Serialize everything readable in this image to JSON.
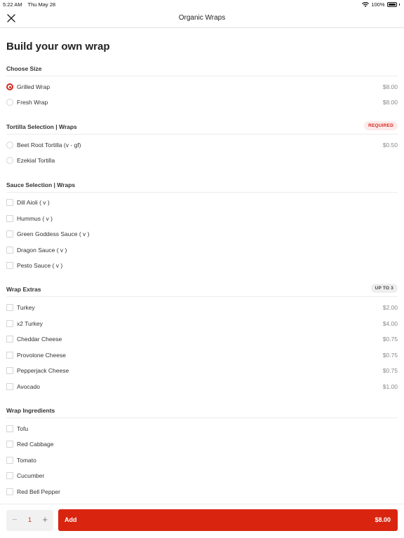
{
  "status_bar": {
    "time": "5:22 AM",
    "date": "Thu May 28",
    "battery": "100%"
  },
  "nav": {
    "title": "Organic Wraps",
    "close_icon": "close-icon"
  },
  "page_title": "Build your own wrap",
  "sections": {
    "size": {
      "title": "Choose Size",
      "options": [
        {
          "label": "Grilled Wrap",
          "price": "$8.00",
          "selected": true
        },
        {
          "label": "Fresh Wrap",
          "price": "$8.00",
          "selected": false
        }
      ]
    },
    "tortilla": {
      "title": "Tortilla Selection | Wraps",
      "badge": "REQUIRED",
      "options": [
        {
          "label": "Beet Root Tortilla (v - gf)",
          "price": "$0.50"
        },
        {
          "label": "Ezekial Tortilla",
          "price": ""
        }
      ]
    },
    "sauce": {
      "title": "Sauce Selection | Wraps",
      "options": [
        {
          "label": "Dill Aioli ( v )"
        },
        {
          "label": "Hummus ( v )"
        },
        {
          "label": "Green Goddess Sauce ( v )"
        },
        {
          "label": "Dragon Sauce ( v )"
        },
        {
          "label": "Pesto Sauce ( v )"
        }
      ]
    },
    "extras": {
      "title": "Wrap Extras",
      "badge": "UP TO 3",
      "options": [
        {
          "label": "Turkey",
          "price": "$2.00"
        },
        {
          "label": "x2 Turkey",
          "price": "$4.00"
        },
        {
          "label": "Cheddar Cheese",
          "price": "$0.75"
        },
        {
          "label": "Provolone Cheese",
          "price": "$0.75"
        },
        {
          "label": "Pepperjack Cheese",
          "price": "$0.75"
        },
        {
          "label": "Avocado",
          "price": "$1.00"
        }
      ]
    },
    "ingredients": {
      "title": "Wrap Ingredients",
      "options": [
        {
          "label": "Tofu"
        },
        {
          "label": "Red Cabbage"
        },
        {
          "label": "Tomato"
        },
        {
          "label": "Cucumber"
        },
        {
          "label": "Red Bell Pepper"
        }
      ]
    }
  },
  "footer": {
    "quantity": "1",
    "minus": "−",
    "plus": "+",
    "add_label": "Add",
    "add_price": "$8.00"
  },
  "colors": {
    "accent": "#d9240f",
    "required_bg": "#fdeaea"
  }
}
